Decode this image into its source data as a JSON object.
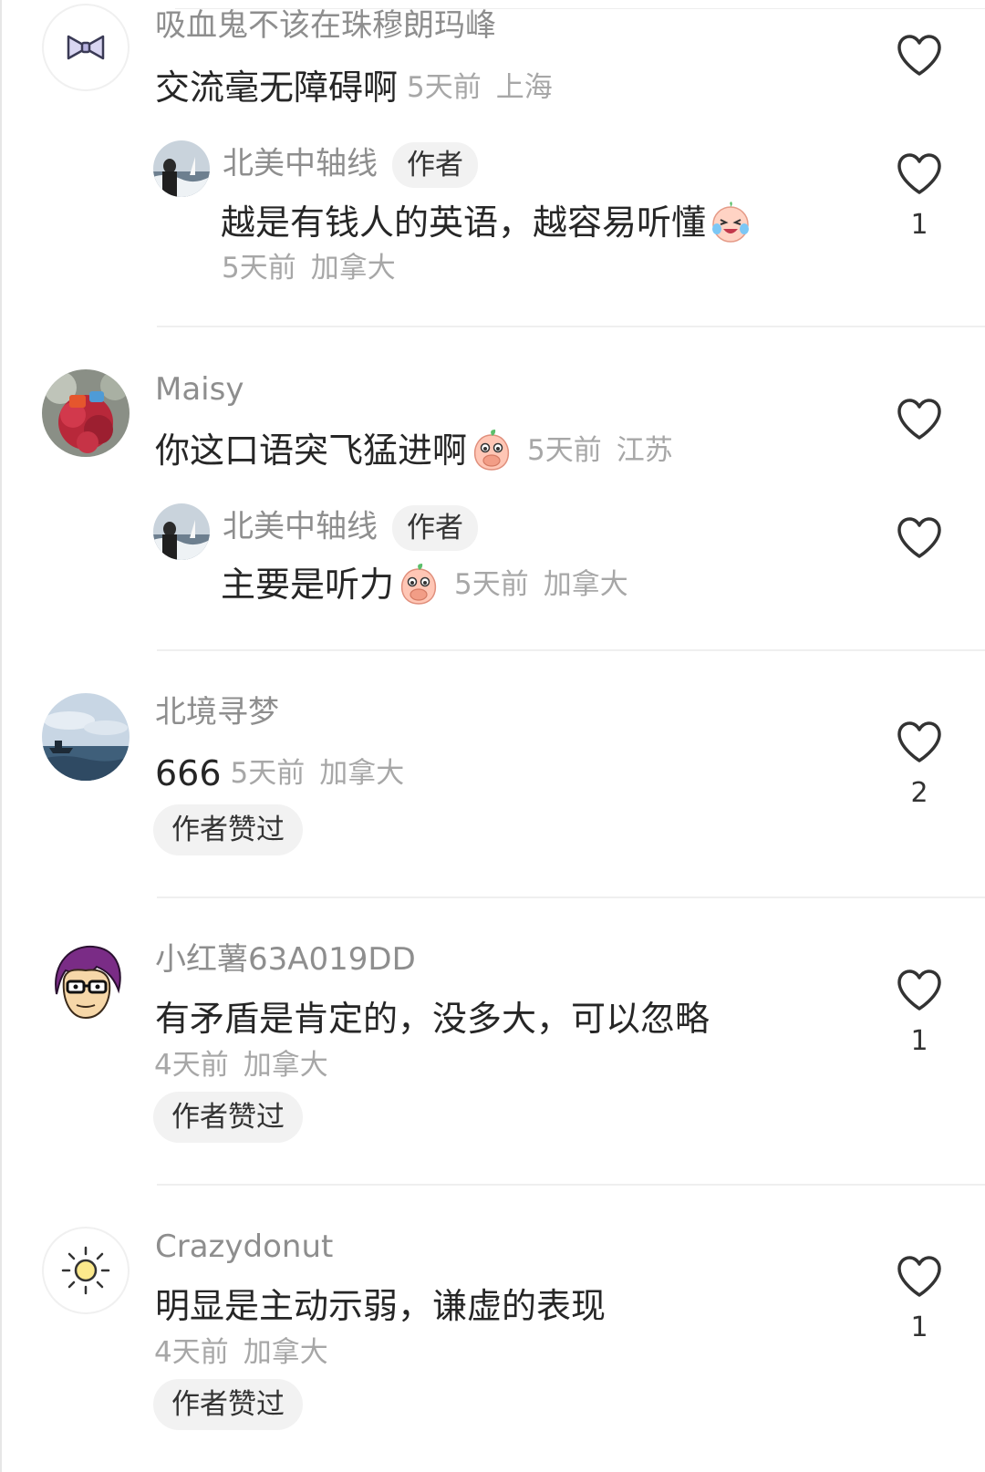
{
  "comments": [
    {
      "username": "吸血鬼不该在珠穆朗玛峰",
      "text": "交流毫无障碍啊",
      "time": "5天前",
      "location": "上海",
      "likes": "",
      "avatar_icon": "bow-tie-icon",
      "reply": {
        "username": "北美中轴线",
        "tag": "作者",
        "text": "越是有钱人的英语，越容易听懂",
        "emoji": "crying-laughing-face-icon",
        "time": "5天前",
        "location": "加拿大",
        "likes": "1"
      }
    },
    {
      "username": "Maisy",
      "text": "你这口语突飞猛进啊",
      "emoji": "peach-covering-mouth-icon",
      "time": "5天前",
      "location": "江苏",
      "likes": "",
      "avatar_icon": "red-flowers-photo",
      "reply": {
        "username": "北美中轴线",
        "tag": "作者",
        "text": "主要是听力",
        "emoji": "peach-covering-mouth-icon",
        "time": "5天前",
        "location": "加拿大",
        "likes": ""
      }
    },
    {
      "username": "北境寻梦",
      "text": "666",
      "time": "5天前",
      "location": "加拿大",
      "likes": "2",
      "badge": "作者赞过",
      "avatar_icon": "sea-ship-photo"
    },
    {
      "username": "小红薯63A019DD",
      "text": "有矛盾是肯定的，没多大，可以忽略",
      "time": "4天前",
      "location": "加拿大",
      "likes": "1",
      "badge": "作者赞过",
      "avatar_icon": "cartoon-man-glasses-icon"
    },
    {
      "username": "Crazydonut",
      "text": "明显是主动示弱，谦虚的表现",
      "time": "4天前",
      "location": "加拿大",
      "likes": "1",
      "badge": "作者赞过",
      "avatar_icon": "sun-icon"
    }
  ],
  "colors": {
    "username": "#8e8e8e",
    "text": "#262626",
    "meta": "#a7a7a7",
    "badge_bg": "#f2f2f2"
  }
}
